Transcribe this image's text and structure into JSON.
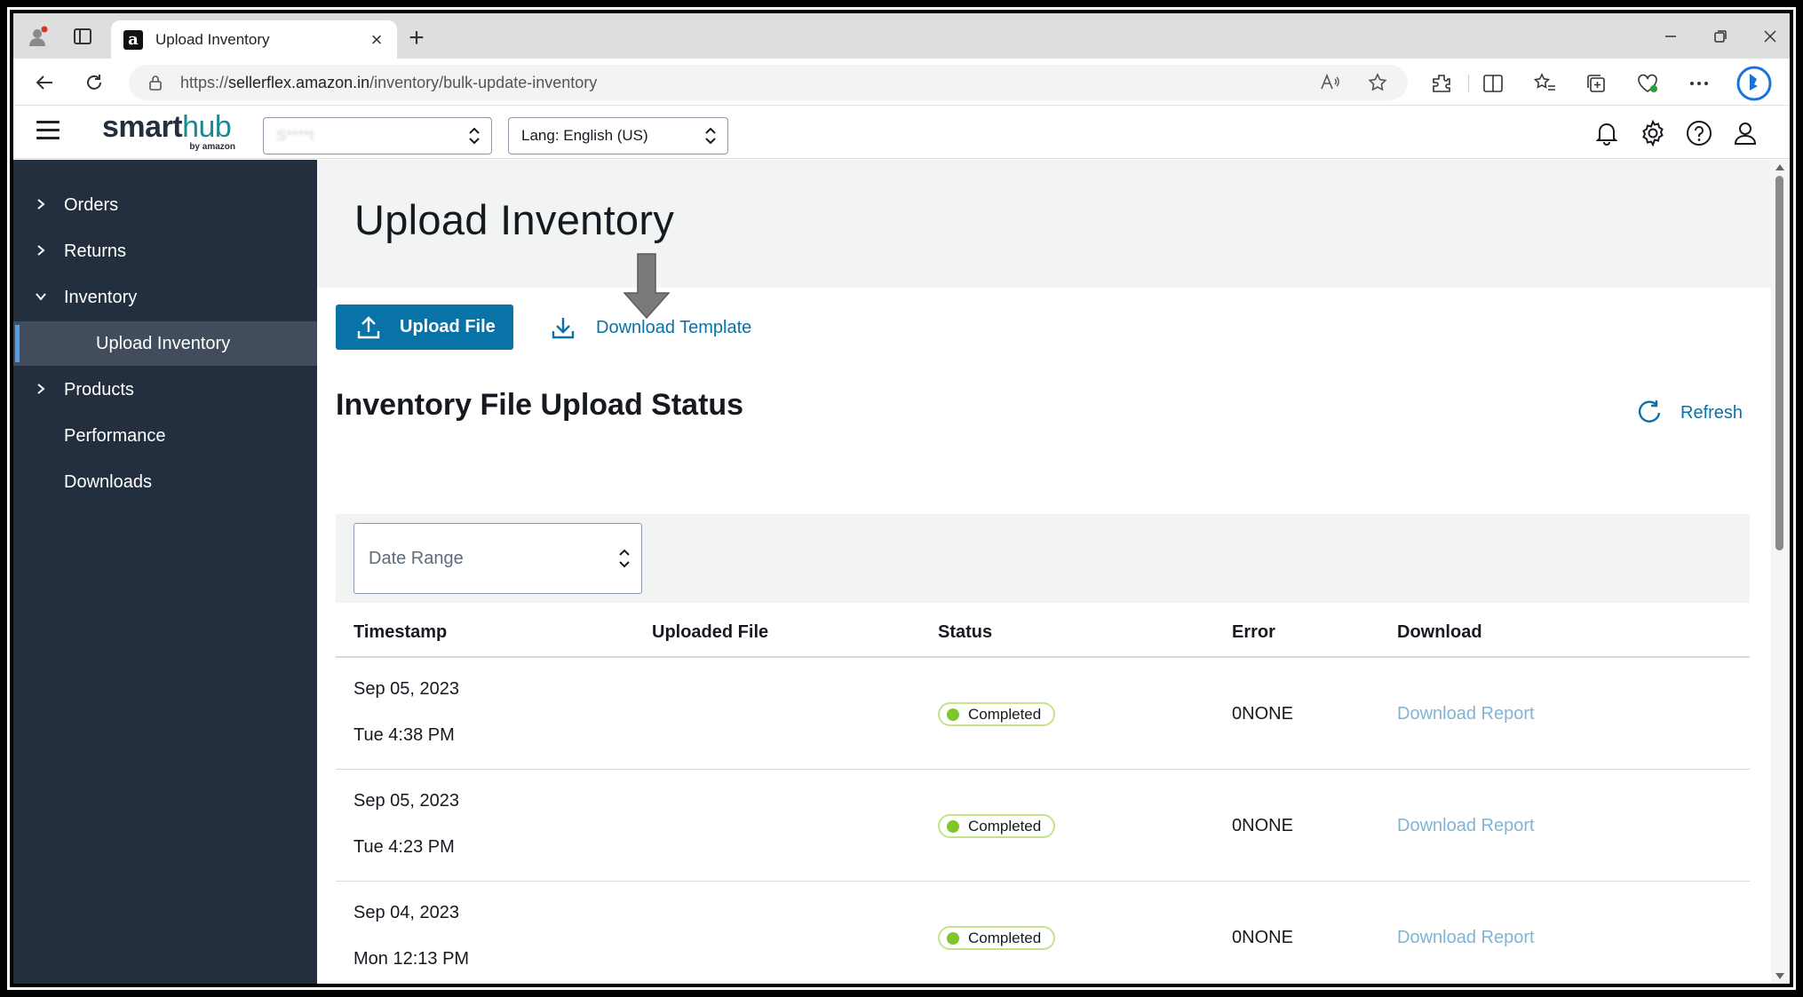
{
  "browser": {
    "tab_title": "Upload Inventory",
    "tab_close": "×",
    "new_tab": "+",
    "url_scheme": "https://",
    "url_host": "sellerflex.amazon.in",
    "url_path": "/inventory/bulk-update-inventory",
    "favicon_letter": "a"
  },
  "header": {
    "logo_smart": "smart",
    "logo_hub": "hub",
    "logo_sub": "by amazon",
    "account_select_value": "S****t",
    "lang_select_value": "Lang: English (US)"
  },
  "sidebar": {
    "items": [
      {
        "label": "Orders",
        "expandable": true,
        "expanded": false
      },
      {
        "label": "Returns",
        "expandable": true,
        "expanded": false
      },
      {
        "label": "Inventory",
        "expandable": true,
        "expanded": true
      },
      {
        "label": "Upload Inventory",
        "sub": true,
        "active": true
      },
      {
        "label": "Products",
        "expandable": true,
        "expanded": false
      },
      {
        "label": "Performance",
        "expandable": false
      },
      {
        "label": "Downloads",
        "expandable": false
      }
    ]
  },
  "main": {
    "page_title": "Upload Inventory",
    "upload_button": "Upload File",
    "download_template": "Download Template",
    "section_title": "Inventory File Upload Status",
    "refresh": "Refresh",
    "date_range_placeholder": "Date Range",
    "columns": [
      "Timestamp",
      "Uploaded File",
      "Status",
      "Error",
      "Download"
    ],
    "rows": [
      {
        "date": "Sep 05, 2023",
        "time": "Tue 4:38 PM",
        "file": "",
        "status": "Completed",
        "error": "0NONE",
        "download": "Download Report"
      },
      {
        "date": "Sep 05, 2023",
        "time": "Tue 4:23 PM",
        "file": "",
        "status": "Completed",
        "error": "0NONE",
        "download": "Download Report"
      },
      {
        "date": "Sep 04, 2023",
        "time": "Mon 12:13 PM",
        "file": "",
        "status": "Completed",
        "error": "0NONE",
        "download": "Download Report"
      }
    ]
  },
  "colors": {
    "sidebar_bg": "#232f3e",
    "primary": "#0972a6",
    "status_green": "#7ec62b"
  }
}
